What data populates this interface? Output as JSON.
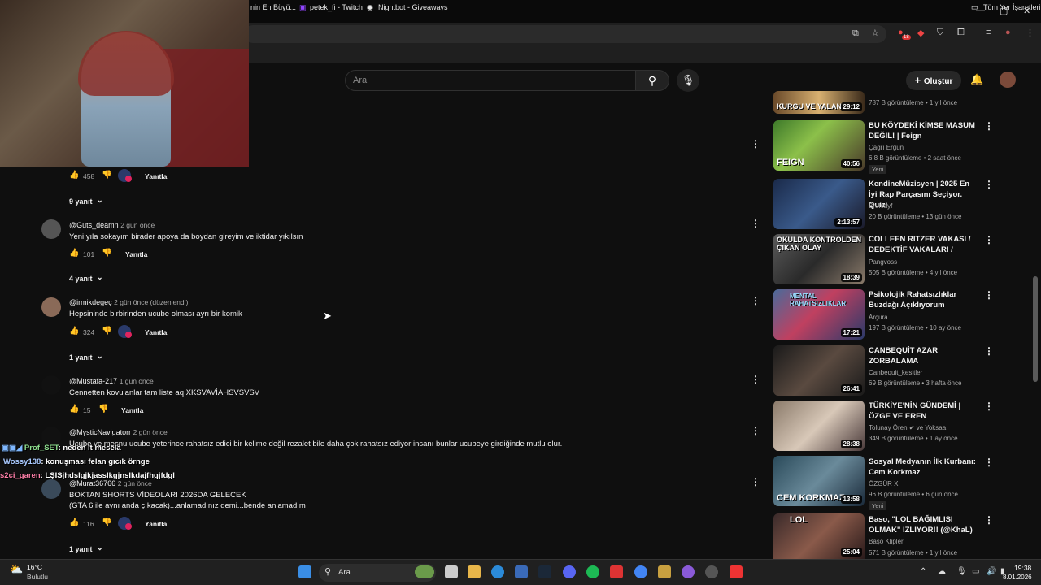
{
  "browser": {
    "bookmarks": [
      {
        "label": "nin En Büyü..."
      },
      {
        "label": "petek_fi - Twitch"
      },
      {
        "label": "Nightbot - Giveaways"
      }
    ],
    "all_bookmarks_label": "Tüm Yer İşaretleri",
    "ext_badge": "18"
  },
  "youtube": {
    "search_placeholder": "Ara",
    "create_label": "Oluştur",
    "comments": [
      {
        "likes": "458",
        "reply_label": "Yanıtla",
        "replies": "9 yanıt"
      },
      {
        "author": "@Guts_deamn",
        "time": "2 gün önce",
        "text": "Yeni yıla sokayım birader apoya da boydan gireyim ve iktidar yıkılsın",
        "likes": "101",
        "reply_label": "Yanıtla",
        "replies": "4 yanıt"
      },
      {
        "author": "@irmikdegeç",
        "time": "2 gün önce (düzenlendi)",
        "text": "Hepsininde birbirinden ucube olması ayrı bir komik",
        "likes": "324",
        "reply_label": "Yanıtla",
        "replies": "1 yanıt"
      },
      {
        "author": "@Mustafa-217",
        "time": "1 gün önce",
        "text": "Cennetten kovulanlar tam liste aq XKSVAVİAHSVSVSV",
        "likes": "15",
        "reply_label": "Yanıtla"
      },
      {
        "author": "@MysticNavigatorr",
        "time": "2 gün önce",
        "text": "Ucube ve mesnu ucube yeterince rahatsız edici bir kelime değil rezalet bile daha çok rahatsız ediyor insanı bunlar ucubeye girdiğinde mutlu olur."
      },
      {
        "author": "@Murat36766",
        "time": "2 gün önce",
        "text": "BOKTAN SHORTS VİDEOLARI 2026DA GELECEK",
        "text2": "(GTA 6 ile aynı anda çıkacak)...anlamadınız demi...bende anlamadım",
        "likes": "116",
        "reply_label": "Yanıtla",
        "replies": "1 yanıt"
      }
    ],
    "chat": [
      {
        "user": "Prof_SET",
        "msg": ": neden it mesela"
      },
      {
        "user": "Wossy138",
        "msg": ": konuşması felan gıcık örnge"
      },
      {
        "user": "s2ci_garen",
        "msg": ": LŞISjhdslgjkjasslkgjnslkdajfhgjfdgl"
      }
    ],
    "sidebar": [
      {
        "thumb_text": "KURGU VE YALAN",
        "duration": "29:12",
        "meta": "787 B görüntüleme • 1 yıl önce"
      },
      {
        "thumb_text": "FEIGN",
        "title": "BU KÖYDEKİ KİMSE MASUM DEĞİL! | Feign",
        "channel": "Çağrı Ergün",
        "duration": "40:56",
        "meta": "6,8 B görüntüleme • 2 saat önce",
        "badge": "Yeni"
      },
      {
        "thumb_text": "",
        "title": "KendineMüzisyen | 2025 En İyi Rap Parçasını Seçiyor. Quizi",
        "channel": "Bruhlayf",
        "duration": "2:13:57",
        "meta": "20 B görüntüleme • 13 gün önce"
      },
      {
        "thumb_text": "OKULDA KONTROLDEN ÇIKAN OLAY",
        "title": "COLLEEN RITZER VAKASI / DEDEKTİF VAKALARI /",
        "channel": "Pangvoss",
        "duration": "18:39",
        "meta": "505 B görüntüleme • 4 yıl önce"
      },
      {
        "thumb_text": "MENTAL RAHATSIZLIKLAR",
        "title": "Psikolojik Rahatsızlıklar Buzdağı Açıklıyorum",
        "channel": "Arçura",
        "duration": "17:21",
        "meta": "197 B görüntüleme • 10 ay önce"
      },
      {
        "thumb_text": "",
        "title": "CANBEQUİT AZAR ZORBALAMA",
        "channel": "Canbequit_kesitler",
        "duration": "26:41",
        "meta": "69 B görüntüleme • 3 hafta önce"
      },
      {
        "thumb_text": "",
        "title": "TÜRKİYE'NİN GÜNDEMİ | ÖZGE VE EREN",
        "channel": "Tolunay Ören ✔ ve Yoksaa",
        "duration": "28:38",
        "meta": "349 B görüntüleme • 1 ay önce"
      },
      {
        "thumb_text": "CEM KORKMAZ",
        "title": "Sosyal Medyanın İlk Kurbanı: Cem Korkmaz",
        "channel": "ÖZGÜR X",
        "duration": "13:58",
        "meta": "96 B görüntüleme • 6 gün önce",
        "badge": "Yeni"
      },
      {
        "thumb_text": "LOL",
        "title": "Baso, \"LOL BAĞIMLISI OLMAK\" İZLİYOR!! (@KhaL)",
        "channel": "Başo Klipleri",
        "duration": "25:04",
        "meta": "571 B görüntüleme • 1 yıl önce"
      }
    ]
  },
  "taskbar": {
    "temp": "16°C",
    "condition": "Bulutlu",
    "search_label": "Ara",
    "time": "19:38",
    "date": "8.01.2026"
  },
  "colors": {
    "bg": "#0f0f0f",
    "heart": "#e0245e",
    "chat_user1": "#7fb8ff",
    "chat_user2": "#a9c9ff",
    "chat_user3": "#ff7fa8"
  }
}
